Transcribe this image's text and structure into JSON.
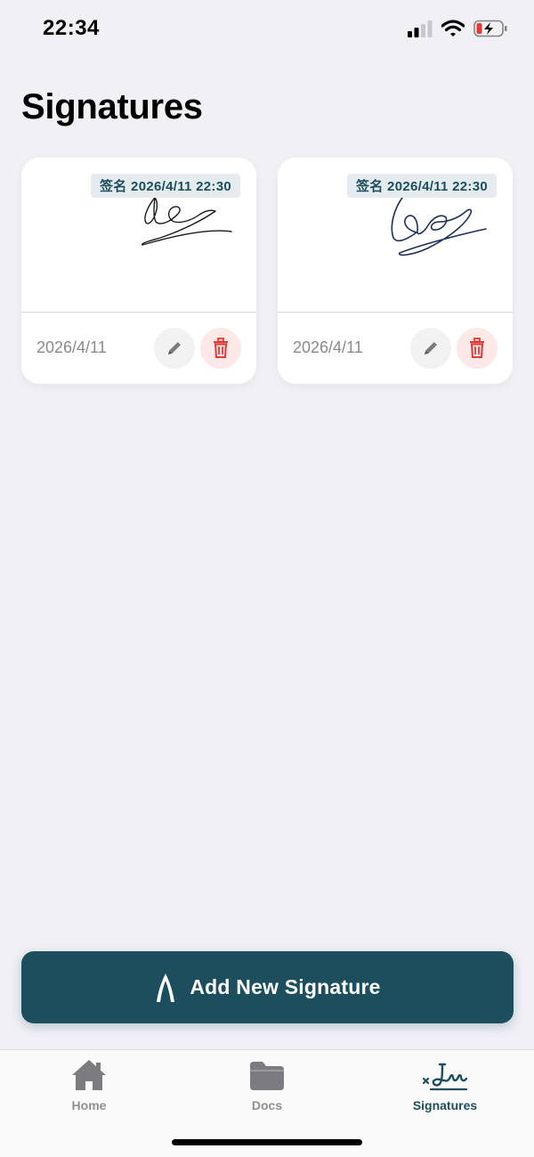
{
  "status_bar": {
    "time": "22:34",
    "icons": [
      "cellular-signal-icon",
      "wifi-icon",
      "battery-charging-icon"
    ]
  },
  "page": {
    "title": "Signatures"
  },
  "signatures": [
    {
      "stamp": "签名 2026/4/11 22:30",
      "date": "2026/4/11",
      "ink_color": "#1a1a1a"
    },
    {
      "stamp": "签名 2026/4/11 22:30",
      "date": "2026/4/11",
      "ink_color": "#1e2f5c"
    }
  ],
  "actions": {
    "add_button_label": "Add New Signature",
    "add_button_icon": "pen-nib-icon"
  },
  "tab_bar": {
    "tabs": [
      {
        "label": "Home",
        "icon": "home-icon",
        "active": false
      },
      {
        "label": "Docs",
        "icon": "folder-icon",
        "active": false
      },
      {
        "label": "Signatures",
        "icon": "signature-icon",
        "active": true
      }
    ]
  },
  "colors": {
    "accent": "#1d4e5e",
    "delete": "#e53935",
    "background": "#f0f0f5"
  }
}
